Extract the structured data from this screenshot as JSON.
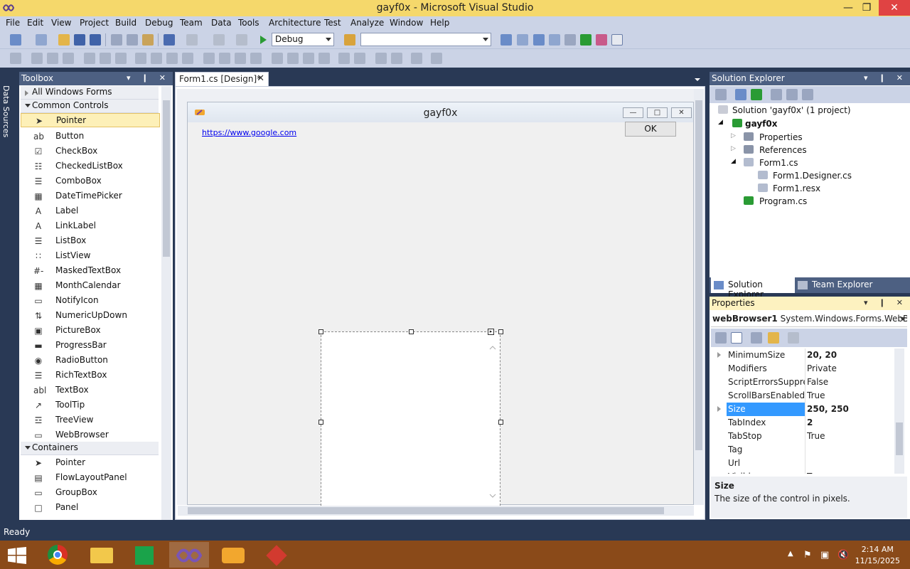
{
  "window": {
    "title": "gayf0x - Microsoft Visual Studio",
    "minimize": "—",
    "restore": "❐",
    "close": "✕"
  },
  "menu": [
    "File",
    "Edit",
    "View",
    "Project",
    "Build",
    "Debug",
    "Team",
    "Data",
    "Tools",
    "Architecture",
    "Test",
    "Analyze",
    "Window",
    "Help"
  ],
  "toolbar": {
    "config_value": "Debug",
    "platform_value": ""
  },
  "left_strip": {
    "label": "Data Sources"
  },
  "toolbox": {
    "title": "Toolbox",
    "header_buttons": "▾ ❙ ✕",
    "group_all": "All Windows Forms",
    "group_common": "Common Controls",
    "common_items": [
      {
        "label": "Pointer",
        "icon": "➤"
      },
      {
        "label": "Button",
        "icon": "ab"
      },
      {
        "label": "CheckBox",
        "icon": "☑"
      },
      {
        "label": "CheckedListBox",
        "icon": "☷"
      },
      {
        "label": "ComboBox",
        "icon": "☰"
      },
      {
        "label": "DateTimePicker",
        "icon": "▦"
      },
      {
        "label": "Label",
        "icon": "A"
      },
      {
        "label": "LinkLabel",
        "icon": "A"
      },
      {
        "label": "ListBox",
        "icon": "☰"
      },
      {
        "label": "ListView",
        "icon": "∷"
      },
      {
        "label": "MaskedTextBox",
        "icon": "#-"
      },
      {
        "label": "MonthCalendar",
        "icon": "▦"
      },
      {
        "label": "NotifyIcon",
        "icon": "▭"
      },
      {
        "label": "NumericUpDown",
        "icon": "⇅"
      },
      {
        "label": "PictureBox",
        "icon": "▣"
      },
      {
        "label": "ProgressBar",
        "icon": "▬"
      },
      {
        "label": "RadioButton",
        "icon": "◉"
      },
      {
        "label": "RichTextBox",
        "icon": "☰"
      },
      {
        "label": "TextBox",
        "icon": "abl"
      },
      {
        "label": "ToolTip",
        "icon": "↗"
      },
      {
        "label": "TreeView",
        "icon": "☲"
      },
      {
        "label": "WebBrowser",
        "icon": "▭"
      }
    ],
    "group_containers": "Containers",
    "container_items": [
      {
        "label": "Pointer",
        "icon": "➤"
      },
      {
        "label": "FlowLayoutPanel",
        "icon": "▤"
      },
      {
        "label": "GroupBox",
        "icon": "▭"
      },
      {
        "label": "Panel",
        "icon": "□"
      }
    ]
  },
  "designer": {
    "tab_label": "Form1.cs [Design]*",
    "tab_close": "✕",
    "form_title": "gayf0x",
    "form_min": "—",
    "form_max": "□",
    "form_close": "✕",
    "ok_label": "OK",
    "link_text": "https://www.google.com"
  },
  "solution_explorer": {
    "title": "Solution Explorer",
    "header_buttons": "▾ ❙ ✕",
    "solution": "Solution 'gayf0x' (1 project)",
    "project": "gayf0x",
    "items": [
      "Properties",
      "References",
      "Form1.cs",
      "Form1.Designer.cs",
      "Form1.resx",
      "Program.cs"
    ],
    "tab_solution": "Solution Explorer",
    "tab_team": "Team Explorer"
  },
  "properties": {
    "title": "Properties",
    "header_buttons": "▾ ❙ ✕",
    "object_name": "webBrowser1",
    "object_type": "System.Windows.Forms.WebBro",
    "rows": [
      {
        "name": "MinimumSize",
        "value": "20, 20"
      },
      {
        "name": "Modifiers",
        "value": "Private"
      },
      {
        "name": "ScriptErrorsSuppressed",
        "value": "False"
      },
      {
        "name": "ScrollBarsEnabled",
        "value": "True"
      },
      {
        "name": "Size",
        "value": "250, 250"
      },
      {
        "name": "TabIndex",
        "value": "2"
      },
      {
        "name": "TabStop",
        "value": "True"
      },
      {
        "name": "Tag",
        "value": ""
      },
      {
        "name": "Url",
        "value": ""
      },
      {
        "name": "Visible",
        "value": "True"
      }
    ],
    "desc_title": "Size",
    "desc_text": "The size of the control in pixels."
  },
  "status": {
    "text": "Ready"
  },
  "taskbar": {
    "time": "2:14 AM",
    "date": "11/15/2025"
  },
  "colors": {
    "titlebar": "#f5d86b",
    "chrome": "#293955",
    "panel_header": "#4d6082",
    "selection": "#3399ff",
    "taskbar": "#8a4a19"
  }
}
